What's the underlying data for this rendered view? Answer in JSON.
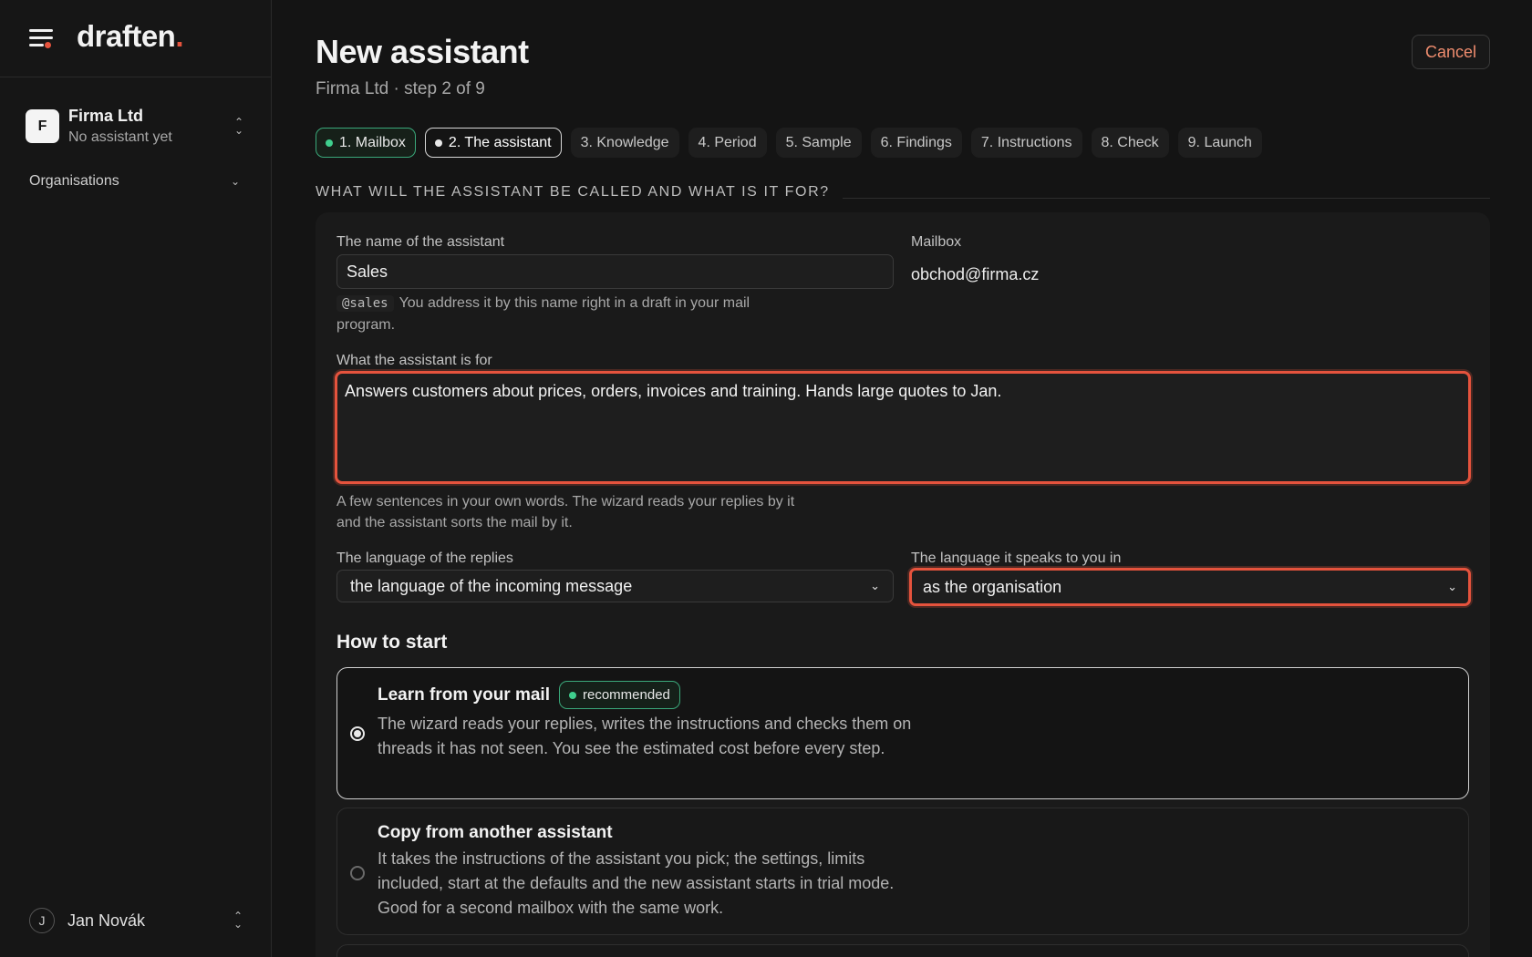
{
  "brand": {
    "name": "draften",
    "dot": "."
  },
  "sidebar": {
    "org": {
      "initial": "F",
      "name": "Firma Ltd",
      "sub": "No assistant yet"
    },
    "section": "Organisations",
    "user": {
      "initial": "J",
      "name": "Jan Novák"
    }
  },
  "page": {
    "title": "New assistant",
    "subtitle": "Firma Ltd · step 2 of 9",
    "cancel": "Cancel"
  },
  "steps": [
    {
      "label": "1. Mailbox",
      "state": "done"
    },
    {
      "label": "2. The assistant",
      "state": "current"
    },
    {
      "label": "3. Knowledge",
      "state": "todo"
    },
    {
      "label": "4. Period",
      "state": "todo"
    },
    {
      "label": "5. Sample",
      "state": "todo"
    },
    {
      "label": "6. Findings",
      "state": "todo"
    },
    {
      "label": "7. Instructions",
      "state": "todo"
    },
    {
      "label": "8. Check",
      "state": "todo"
    },
    {
      "label": "9. Launch",
      "state": "todo"
    }
  ],
  "form": {
    "section_heading": "WHAT WILL THE ASSISTANT BE CALLED AND WHAT IS IT FOR?",
    "name_label": "The name of the assistant",
    "name_value": "Sales",
    "handle": "@sales",
    "name_hint": "You address it by this name right in a draft in your mail program.",
    "mailbox_label": "Mailbox",
    "mailbox_value": "obchod@firma.cz",
    "purpose_label": "What the assistant is for",
    "purpose_value": "Answers customers about prices, orders, invoices and training. Hands large quotes to Jan.",
    "purpose_hint": "A few sentences in your own words. The wizard reads your replies by it and the assistant sorts the mail by it.",
    "reply_lang_label": "The language of the replies",
    "reply_lang_value": "the language of the incoming message",
    "ui_lang_label": "The language it speaks to you in",
    "ui_lang_value": "as the organisation"
  },
  "start": {
    "heading": "How to start",
    "options": [
      {
        "title": "Learn from your mail",
        "badge": "recommended",
        "desc": "The wizard reads your replies, writes the instructions and checks them on threads it has not seen. You see the estimated cost before every step.",
        "selected": true
      },
      {
        "title": "Copy from another assistant",
        "desc": "It takes the instructions of the assistant you pick; the settings, limits included, start at the defaults and the new assistant starts in trial mode. Good for a second mailbox with the same work.",
        "selected": false
      }
    ]
  },
  "colors": {
    "accent": "#e5533d",
    "success": "#3fcf8e",
    "cancel_text": "#ee8c6e",
    "background": "#141414"
  }
}
